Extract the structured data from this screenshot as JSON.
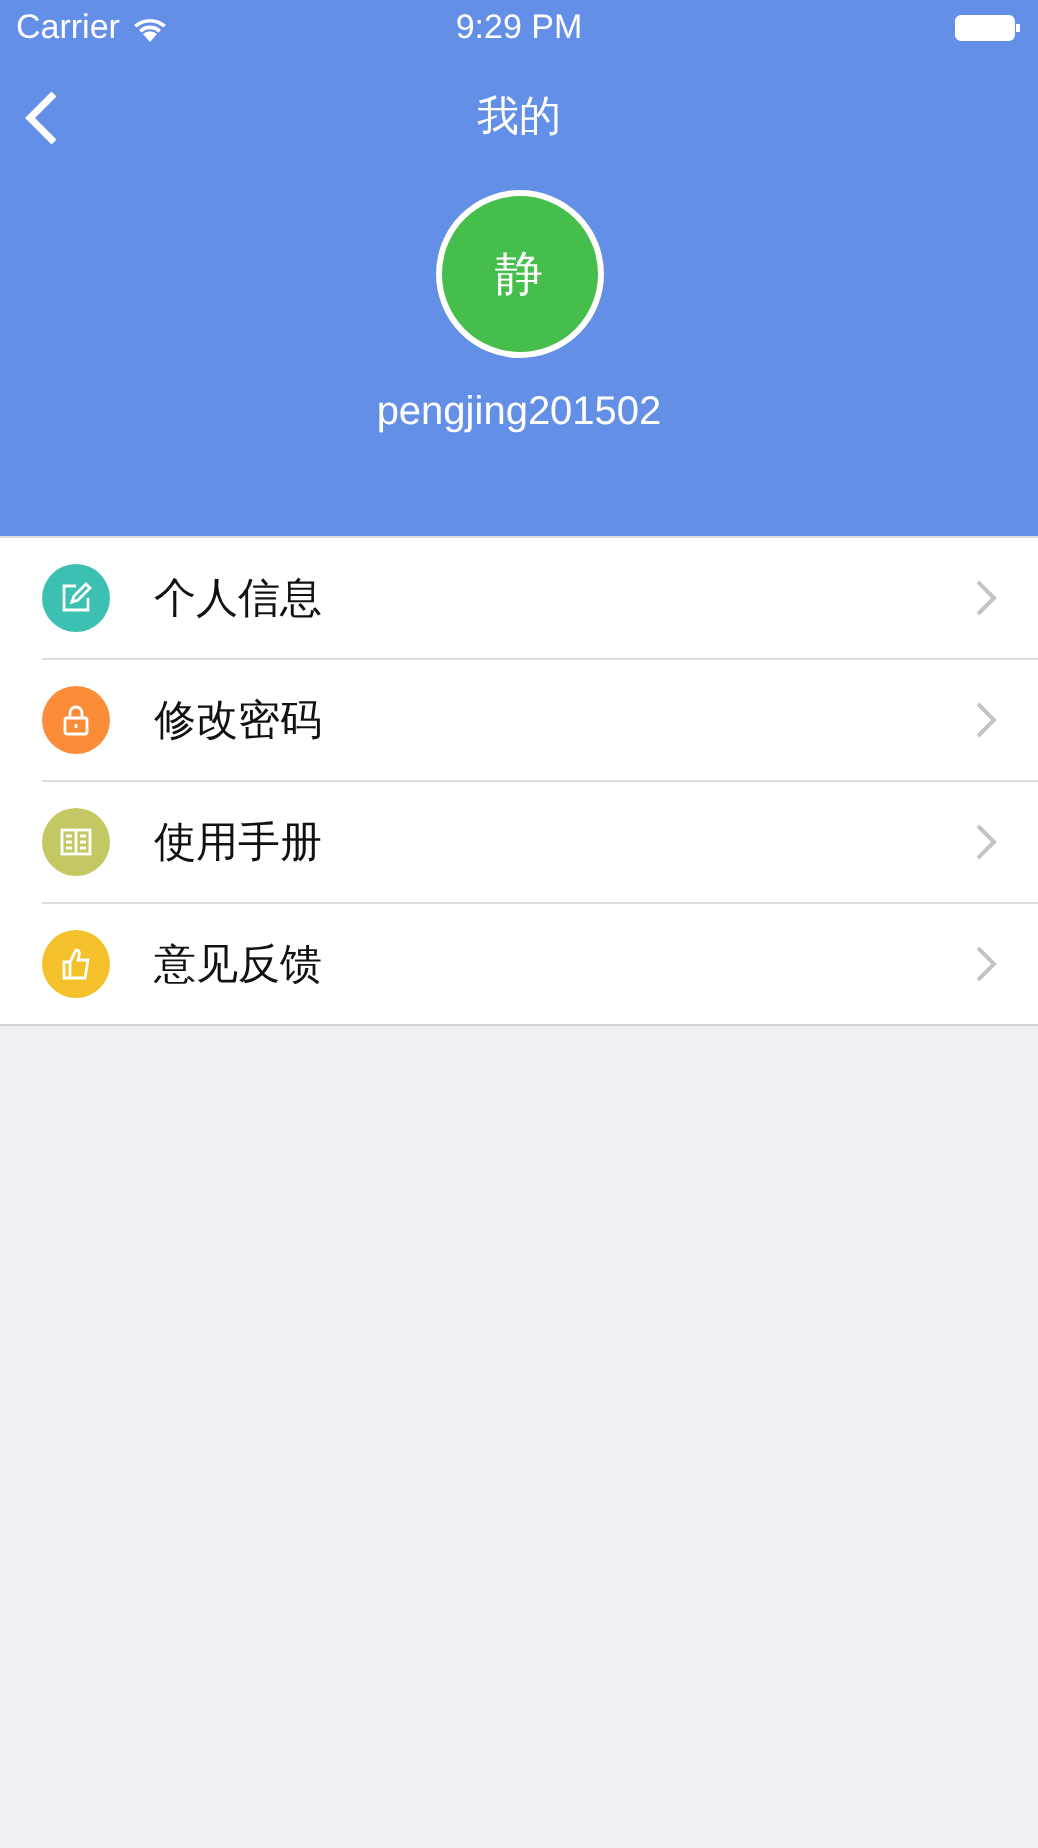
{
  "status_bar": {
    "carrier": "Carrier",
    "time": "9:29 PM"
  },
  "nav": {
    "title": "我的"
  },
  "profile": {
    "avatar_text": "静",
    "username": "pengjing201502"
  },
  "menu": [
    {
      "label": "个人信息",
      "kind": "edit",
      "color": "#3cc0b2"
    },
    {
      "label": "修改密码",
      "kind": "lock",
      "color": "#fb8c38"
    },
    {
      "label": "使用手册",
      "kind": "book",
      "color": "#c3c862"
    },
    {
      "label": "意见反馈",
      "kind": "thumb",
      "color": "#f5c12a"
    }
  ]
}
